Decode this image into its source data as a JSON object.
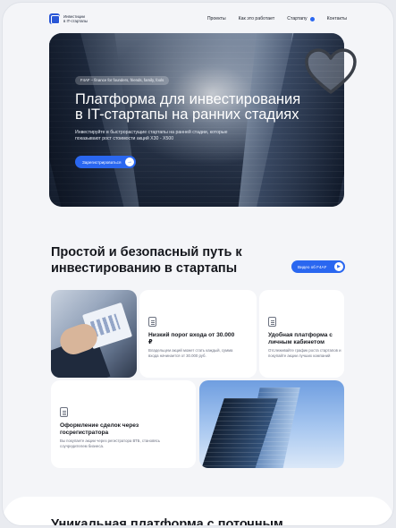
{
  "header": {
    "logo_text": "Инвестиции\nв IT-стартапы",
    "nav": [
      "Проекты",
      "Как это работает",
      "Стартапу",
      "Контакты"
    ]
  },
  "hero": {
    "tagline": "F4AF – finance for founders, friends, family, fools",
    "title": "Платформа для инвестирования в IT-стартапы на ранних стадиях",
    "subtitle": "Инвестируйте в быстрорастущие стартапы на ранней стадии, которые показывают рост стоимости акций X30 - X500",
    "cta": "Зарегистрироваться",
    "cta_icon": "arrow-right-icon",
    "heart_icon": "heart-icon"
  },
  "section_path": {
    "title": "Простой и безопасный путь к инвестированию в стартапы",
    "video_button": "Видео об F4AF",
    "video_icon": "play-icon"
  },
  "cards": [
    {
      "icon": "wallet-icon",
      "title": "Низкий порог входа от 30.000 ₽",
      "text": "Владельцем акций может стать каждый, сумма входа начинается от 30.000 руб."
    },
    {
      "icon": "phone-icon",
      "title": "Удобная платформа с личным кабинетом",
      "text": "Отслеживайте график роста стартапов и покупайте акции лучших компаний"
    },
    {
      "icon": "document-icon",
      "title": "Оформление сделок через госрегистратора",
      "text": "Вы покупаете акции через регистратора ВТБ, становясь соучредителем бизнеса."
    }
  ],
  "bottom": {
    "title": "Уникальная платформа с поточным"
  }
}
